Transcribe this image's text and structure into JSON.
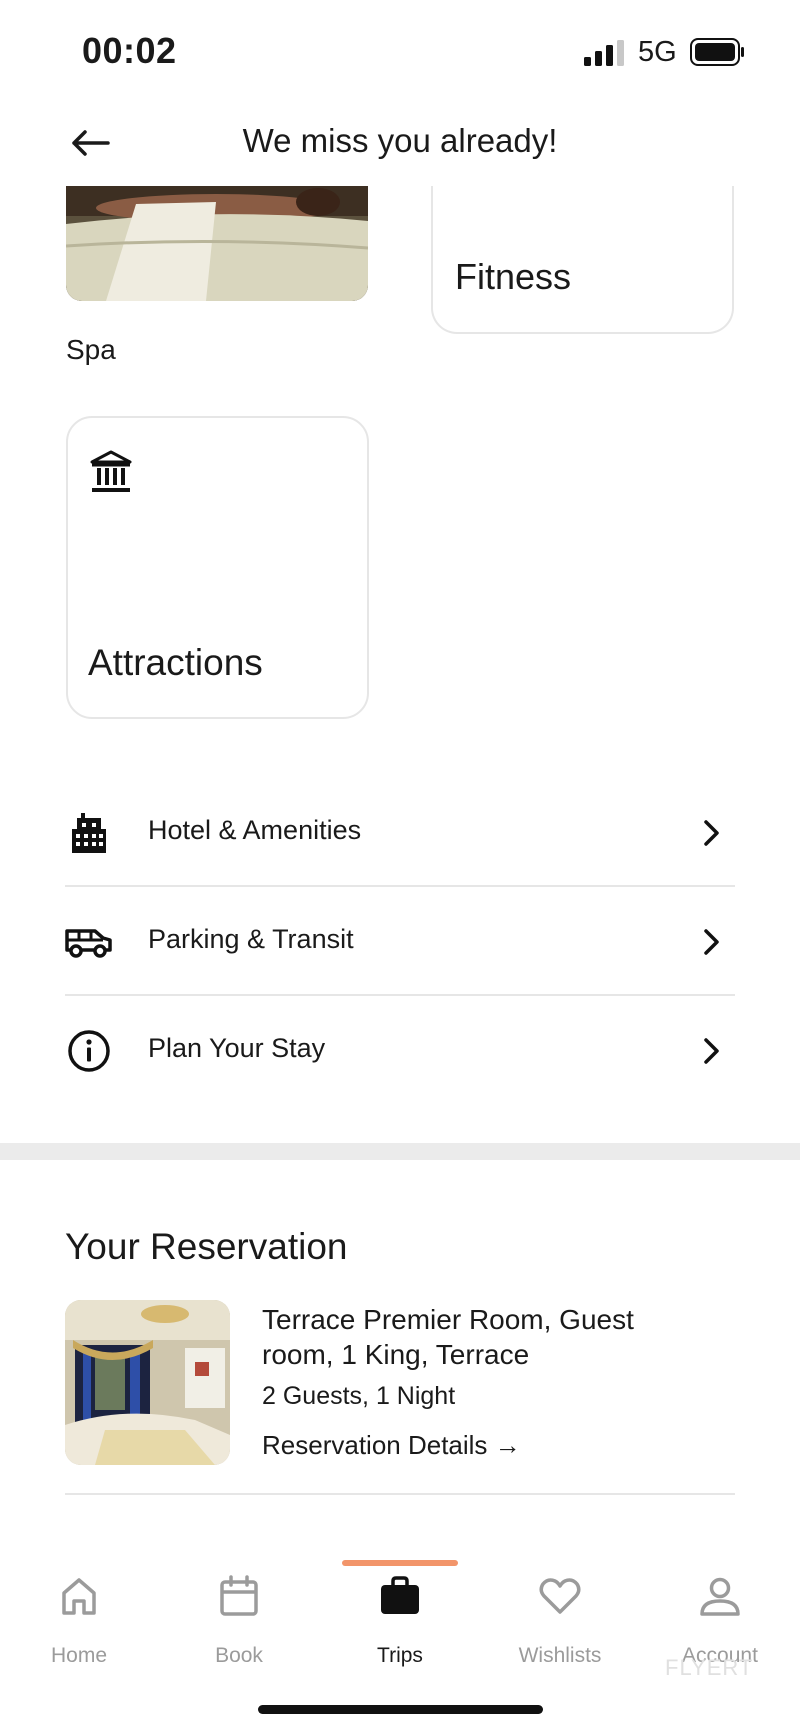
{
  "status_bar": {
    "time": "00:02",
    "network": "5G"
  },
  "header": {
    "title": "We miss you already!"
  },
  "cards": {
    "spa": {
      "label": "Spa"
    },
    "fitness": {
      "label": "Fitness"
    },
    "attractions": {
      "label": "Attractions"
    }
  },
  "list": {
    "items": [
      {
        "label": "Hotel & Amenities",
        "icon": "building-icon"
      },
      {
        "label": "Parking & Transit",
        "icon": "van-icon"
      },
      {
        "label": "Plan Your Stay",
        "icon": "info-icon"
      }
    ]
  },
  "reservation": {
    "heading": "Your Reservation",
    "room": "Terrace Premier Room, Guest room, 1 King, Terrace",
    "guests": "2 Guests, 1 Night",
    "details_label": "Reservation Details →"
  },
  "tabbar": {
    "tabs": [
      {
        "label": "Home",
        "icon": "home-icon"
      },
      {
        "label": "Book",
        "icon": "calendar-icon"
      },
      {
        "label": "Trips",
        "icon": "briefcase-icon",
        "active": true
      },
      {
        "label": "Wishlists",
        "icon": "heart-icon"
      },
      {
        "label": "Account",
        "icon": "person-icon"
      }
    ],
    "accent_color": "#f2956a"
  },
  "watermark": "FLYERT"
}
